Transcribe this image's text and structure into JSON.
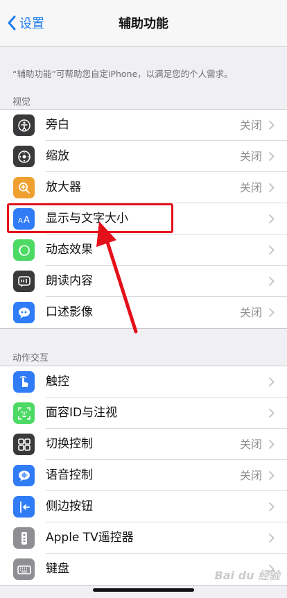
{
  "nav": {
    "back_label": "设置",
    "title": "辅助功能"
  },
  "description": "“辅助功能”可帮助您自定iPhone，以满足您的个人需求。",
  "sections": [
    {
      "header": "视觉",
      "items": [
        {
          "label": "旁白",
          "value": "关闭",
          "icon": "voiceover-icon",
          "icon_color": "#3a3a3c"
        },
        {
          "label": "缩放",
          "value": "关闭",
          "icon": "zoom-icon",
          "icon_color": "#3a3a3c"
        },
        {
          "label": "放大器",
          "value": "关闭",
          "icon": "magnifier-icon",
          "icon_color": "#f0a030"
        },
        {
          "label": "显示与文字大小",
          "value": "",
          "icon": "text-size-icon",
          "icon_color": "#2f7cf6"
        },
        {
          "label": "动态效果",
          "value": "",
          "icon": "motion-icon",
          "icon_color": "#4cd964"
        },
        {
          "label": "朗读内容",
          "value": "",
          "icon": "spoken-content-icon",
          "icon_color": "#3a3a3c"
        },
        {
          "label": "口述影像",
          "value": "关闭",
          "icon": "audio-description-icon",
          "icon_color": "#2f7cf6"
        }
      ]
    },
    {
      "header": "动作交互",
      "items": [
        {
          "label": "触控",
          "value": "",
          "icon": "touch-icon",
          "icon_color": "#2f7cf6"
        },
        {
          "label": "面容ID与注视",
          "value": "",
          "icon": "face-id-icon",
          "icon_color": "#4cd964"
        },
        {
          "label": "切换控制",
          "value": "关闭",
          "icon": "switch-control-icon",
          "icon_color": "#3a3a3c"
        },
        {
          "label": "语音控制",
          "value": "关闭",
          "icon": "voice-control-icon",
          "icon_color": "#2f7cf6"
        },
        {
          "label": "侧边按钮",
          "value": "",
          "icon": "side-button-icon",
          "icon_color": "#2f7cf6"
        },
        {
          "label": "Apple TV遥控器",
          "value": "",
          "icon": "apple-tv-remote-icon",
          "icon_color": "#8e8e93"
        },
        {
          "label": "键盘",
          "value": "",
          "icon": "keyboard-icon",
          "icon_color": "#8e8e93"
        }
      ]
    }
  ],
  "colors": {
    "accent": "#1a7cf2",
    "highlight": "#e3101a",
    "background": "#efeff4"
  }
}
